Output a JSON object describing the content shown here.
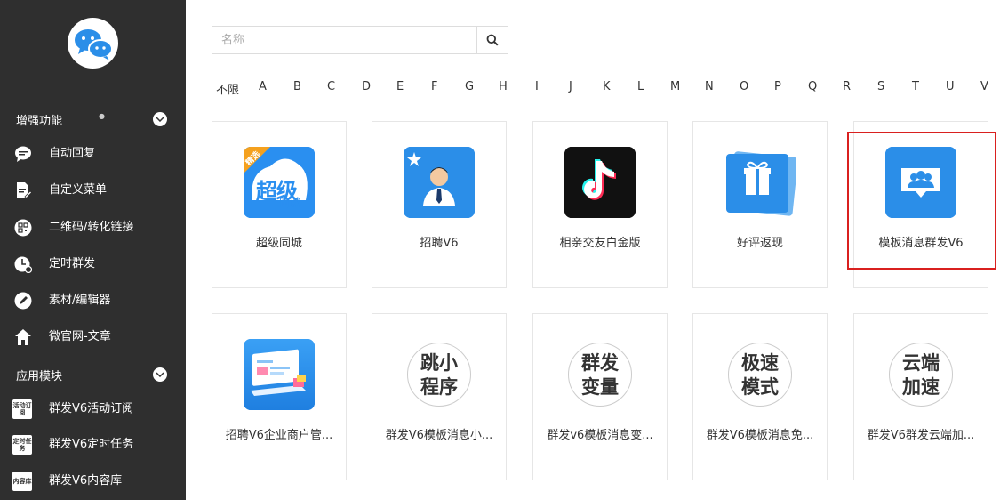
{
  "sidebar": {
    "section1": {
      "label": "增强功能"
    },
    "items1": [
      {
        "label": "自动回复",
        "icon": "chat-bubble-icon"
      },
      {
        "label": "自定义菜单",
        "icon": "document-edit-icon"
      },
      {
        "label": "二维码/转化链接",
        "icon": "qrcode-icon"
      },
      {
        "label": "定时群发",
        "icon": "clock-icon"
      },
      {
        "label": "素材/编辑器",
        "icon": "pencil-icon"
      },
      {
        "label": "微官网-文章",
        "icon": "home-icon"
      }
    ],
    "section2": {
      "label": "应用模块"
    },
    "items2": [
      {
        "label": "群发V6活动订阅",
        "icon_text": "活动订阅"
      },
      {
        "label": "群发V6定时任务",
        "icon_text": "定时任务"
      },
      {
        "label": "群发V6内容库",
        "icon_text": "内容库"
      }
    ]
  },
  "search": {
    "placeholder": "名称"
  },
  "letters": [
    "不限",
    "A",
    "B",
    "C",
    "D",
    "E",
    "F",
    "G",
    "H",
    "I",
    "J",
    "K",
    "L",
    "M",
    "N",
    "O",
    "P",
    "Q",
    "R",
    "S",
    "T",
    "U",
    "V"
  ],
  "cards": [
    {
      "title": "超级同城",
      "icon_line1": "超级",
      "icon_line2": "同城",
      "badge": "精选"
    },
    {
      "title": "招聘V6"
    },
    {
      "title": "相亲交友白金版"
    },
    {
      "title": "好评返现"
    },
    {
      "title": "模板消息群发V6"
    },
    {
      "title": "招聘V6企业商户管..."
    },
    {
      "title": "群发V6模板消息小...",
      "logo": [
        "跳",
        "小",
        "程",
        "序"
      ]
    },
    {
      "title": "群发v6模板消息变...",
      "logo": [
        "群",
        "发",
        "变",
        "量"
      ]
    },
    {
      "title": "群发V6模板消息免...",
      "logo": [
        "极",
        "速",
        "模",
        "式"
      ]
    },
    {
      "title": "群发V6群发云端加...",
      "logo": [
        "云",
        "端",
        "加",
        "速"
      ]
    }
  ],
  "colors": {
    "sidebar_bg": "#2f2f2f",
    "accent_blue": "#2b8ee8",
    "highlight_red": "#d9201f"
  }
}
